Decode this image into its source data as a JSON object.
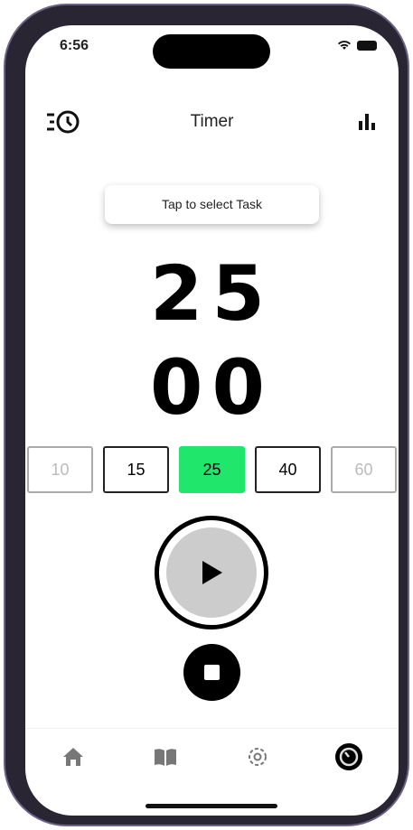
{
  "status_bar": {
    "time": "6:56"
  },
  "header": {
    "title": "Timer",
    "left_icon": "history-clock-icon",
    "right_icon": "bar-chart-icon"
  },
  "task_selector": {
    "label": "Tap to select Task"
  },
  "timer": {
    "minutes": "25",
    "seconds": "00"
  },
  "durations": [
    {
      "label": "10",
      "selected": false
    },
    {
      "label": "15",
      "selected": false
    },
    {
      "label": "25",
      "selected": true
    },
    {
      "label": "40",
      "selected": false
    },
    {
      "label": "60",
      "selected": false
    }
  ],
  "accent_color": "#20e66b",
  "controls": {
    "play_icon": "play-icon",
    "stop_icon": "stop-icon"
  },
  "tabs": [
    {
      "icon": "home-icon",
      "active": false
    },
    {
      "icon": "book-icon",
      "active": false
    },
    {
      "icon": "gear-icon",
      "active": false
    },
    {
      "icon": "timer-icon",
      "active": true
    }
  ]
}
